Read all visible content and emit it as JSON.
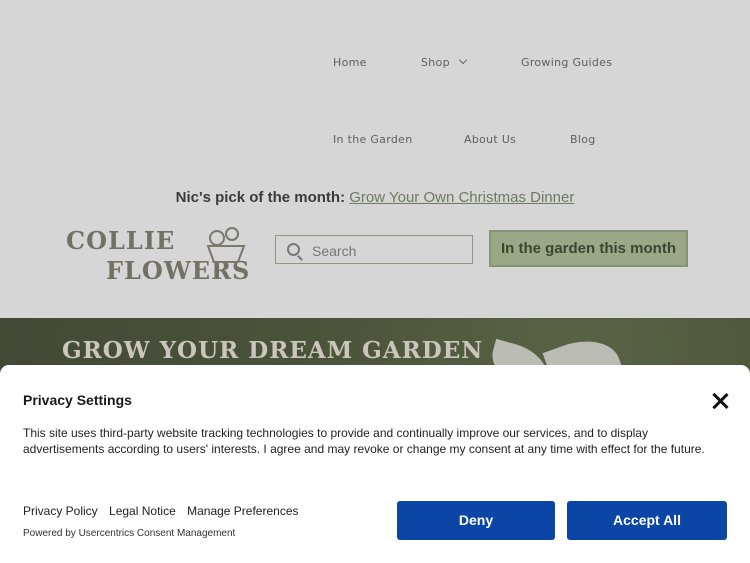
{
  "nav": {
    "home": "Home",
    "shop": "Shop",
    "growing_guides": "Growing Guides",
    "in_the_garden": "In the Garden",
    "about_us": "About Us",
    "blog": "Blog"
  },
  "promo": {
    "prefix": "Nic's pick of the month:",
    "link": "Grow Your Own Christmas Dinner"
  },
  "logo": {
    "line1": "COLLIE",
    "line2": "FLOWERS"
  },
  "search": {
    "placeholder": "Search"
  },
  "cta": {
    "label": "In the garden this month"
  },
  "hero": {
    "title": "GROW YOUR DREAM GARDEN"
  },
  "consent": {
    "title": "Privacy Settings",
    "body": "This site uses third-party website tracking technologies to provide and continually improve our services, and to display advertisements according to users' interests. I agree and may revoke or change my consent at any time with effect for the future.",
    "links": {
      "privacy_policy": "Privacy Policy",
      "legal_notice": "Legal Notice",
      "manage_preferences": "Manage Preferences"
    },
    "powered_by": "Powered by Usercentrics Consent Management",
    "deny": "Deny",
    "accept_all": "Accept All"
  },
  "colors": {
    "primary_button": "#0b45a6",
    "cta_green": "#a9bd8c",
    "hero_dark": "#2a3318"
  },
  "icons": {
    "search": "search-icon",
    "close": "close-icon",
    "dropdown": "chevron-down-icon"
  }
}
